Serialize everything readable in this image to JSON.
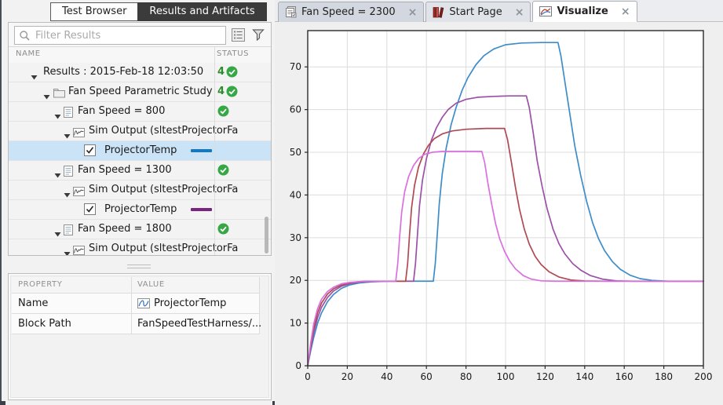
{
  "left_panel": {
    "tabs": [
      {
        "label": "Test Browser",
        "active": false
      },
      {
        "label": "Results and Artifacts",
        "active": true
      }
    ],
    "filter": {
      "placeholder": "Filter Results"
    },
    "tree": {
      "columns": {
        "name": "NAME",
        "status": "STATUS"
      },
      "rows": [
        {
          "label": "Results : 2015-Feb-18 12:03:50",
          "indent": 1,
          "expander": true,
          "icon": "none",
          "status_count": "4",
          "status_check": true,
          "selected": false
        },
        {
          "label": "Fan Speed Parametric Study",
          "indent": 2,
          "expander": true,
          "icon": "folder",
          "status_count": "4",
          "status_check": true,
          "selected": false
        },
        {
          "label": "Fan Speed = 800",
          "indent": 3,
          "expander": true,
          "icon": "document",
          "status_check": true,
          "selected": false
        },
        {
          "label": "Sim Output (sltestProjectorFa",
          "indent": 4,
          "expander": true,
          "icon": "signal",
          "selected": false
        },
        {
          "label": "ProjectorTemp",
          "indent": 5,
          "checkbox": true,
          "swatch": "#1878BE",
          "selected": true
        },
        {
          "label": "Fan Speed = 1300",
          "indent": 3,
          "expander": true,
          "icon": "document",
          "status_check": true,
          "selected": false
        },
        {
          "label": "Sim Output (sltestProjectorFa",
          "indent": 4,
          "expander": true,
          "icon": "signal",
          "selected": false
        },
        {
          "label": "ProjectorTemp",
          "indent": 5,
          "checkbox": true,
          "swatch": "#7A2482",
          "selected": false
        },
        {
          "label": "Fan Speed = 1800",
          "indent": 3,
          "expander": true,
          "icon": "document",
          "status_check": true,
          "selected": false
        },
        {
          "label": "Sim Output (sltestProjectorFa",
          "indent": 4,
          "expander": true,
          "icon": "signal",
          "selected": false
        }
      ]
    },
    "properties": {
      "columns": {
        "property": "PROPERTY",
        "value": "VALUE"
      },
      "rows": [
        {
          "property": "Name",
          "value": "ProjectorTemp",
          "icon": "signal-wave"
        },
        {
          "property": "Block Path",
          "value": "FanSpeedTestHarness/...",
          "icon": "none"
        }
      ]
    },
    "colors": {
      "selected_row": "#CBE3F7",
      "pass_green": "#35A845",
      "count_green": "#2E8B2E",
      "active_tab_bg": "#3B3B3B"
    }
  },
  "right_panel": {
    "tabs": [
      {
        "label": "Fan Speed = 2300",
        "icon": "report-icon",
        "close": "×",
        "active": false
      },
      {
        "label": "Start Page",
        "icon": "books-icon",
        "close": "×",
        "active": false
      },
      {
        "label": "Visualize",
        "icon": "plot-icon",
        "close": "×",
        "active": true
      }
    ]
  },
  "chart_data": {
    "type": "line",
    "title": "",
    "xlabel": "",
    "ylabel": "",
    "xlim": [
      0,
      200
    ],
    "ylim": [
      0,
      78.5
    ],
    "xticks": [
      0,
      20,
      40,
      60,
      80,
      100,
      120,
      140,
      160,
      180,
      200
    ],
    "yticks": [
      0,
      10,
      20,
      30,
      40,
      50,
      60,
      70
    ],
    "grid": true,
    "legend_position": "none",
    "series": [
      {
        "name": "ProjectorTemp (Fan Speed = 800)",
        "color": "#3E8DC9",
        "points": [
          [
            0,
            0
          ],
          [
            1.5,
            3.5
          ],
          [
            3,
            6.6
          ],
          [
            5,
            10
          ],
          [
            7,
            12.4
          ],
          [
            10,
            15
          ],
          [
            13,
            16.7
          ],
          [
            17,
            18.1
          ],
          [
            21,
            18.9
          ],
          [
            26,
            19.4
          ],
          [
            32,
            19.65
          ],
          [
            40,
            19.8
          ],
          [
            63.5,
            19.8
          ],
          [
            64.5,
            24
          ],
          [
            65.5,
            31
          ],
          [
            66.5,
            38
          ],
          [
            68,
            45
          ],
          [
            70,
            51
          ],
          [
            72.5,
            56.5
          ],
          [
            75,
            60.5
          ],
          [
            78,
            64.5
          ],
          [
            81,
            67.5
          ],
          [
            85,
            70.5
          ],
          [
            89,
            72.6
          ],
          [
            94,
            74.2
          ],
          [
            100,
            75.2
          ],
          [
            108,
            75.6
          ],
          [
            118,
            75.7
          ],
          [
            126.5,
            75.7
          ],
          [
            128,
            72.5
          ],
          [
            130,
            66.5
          ],
          [
            132.5,
            59
          ],
          [
            135,
            51.5
          ],
          [
            138,
            44.5
          ],
          [
            141,
            38.5
          ],
          [
            144,
            33.5
          ],
          [
            147,
            29.8
          ],
          [
            150,
            27
          ],
          [
            154,
            24.4
          ],
          [
            158,
            22.6
          ],
          [
            163,
            21.2
          ],
          [
            168,
            20.4
          ],
          [
            174,
            20
          ],
          [
            182,
            19.8
          ],
          [
            200,
            19.8
          ]
        ]
      },
      {
        "name": "ProjectorTemp (Fan Speed = 1300)",
        "color": "#9C50A8",
        "points": [
          [
            0,
            0
          ],
          [
            1.5,
            4.2
          ],
          [
            3,
            7.8
          ],
          [
            5,
            11.3
          ],
          [
            7,
            13.7
          ],
          [
            10,
            16
          ],
          [
            13,
            17.5
          ],
          [
            17,
            18.6
          ],
          [
            21,
            19.2
          ],
          [
            26,
            19.6
          ],
          [
            33,
            19.8
          ],
          [
            53.5,
            19.8
          ],
          [
            54.5,
            24
          ],
          [
            55.5,
            31
          ],
          [
            56.5,
            37.5
          ],
          [
            58,
            43.5
          ],
          [
            60,
            48.5
          ],
          [
            62.5,
            52.8
          ],
          [
            65,
            55.7
          ],
          [
            68,
            58.2
          ],
          [
            71,
            60
          ],
          [
            75,
            61.5
          ],
          [
            80,
            62.4
          ],
          [
            86,
            62.9
          ],
          [
            94,
            63.1
          ],
          [
            102,
            63.2
          ],
          [
            110.5,
            63.2
          ],
          [
            112,
            60.5
          ],
          [
            114,
            54.5
          ],
          [
            116,
            48
          ],
          [
            118.5,
            42
          ],
          [
            121,
            36.8
          ],
          [
            124,
            32
          ],
          [
            127,
            28.6
          ],
          [
            130,
            26.2
          ],
          [
            134,
            23.9
          ],
          [
            138,
            22.4
          ],
          [
            143,
            21.1
          ],
          [
            149,
            20.3
          ],
          [
            156,
            19.9
          ],
          [
            164,
            19.8
          ],
          [
            200,
            19.8
          ]
        ]
      },
      {
        "name": "ProjectorTemp (Fan Speed = 1800)",
        "color": "#B04A52",
        "points": [
          [
            0,
            0
          ],
          [
            1.5,
            4.8
          ],
          [
            3,
            8.8
          ],
          [
            5,
            12.4
          ],
          [
            7,
            14.7
          ],
          [
            10,
            16.8
          ],
          [
            13,
            18
          ],
          [
            17,
            18.9
          ],
          [
            21,
            19.4
          ],
          [
            26,
            19.7
          ],
          [
            32,
            19.8
          ],
          [
            49.5,
            19.8
          ],
          [
            50.5,
            24
          ],
          [
            51.5,
            31
          ],
          [
            52.5,
            37
          ],
          [
            54,
            42.3
          ],
          [
            56,
            46.5
          ],
          [
            58.5,
            49.6
          ],
          [
            61,
            51.6
          ],
          [
            64,
            53.2
          ],
          [
            68,
            54.3
          ],
          [
            73,
            55
          ],
          [
            80,
            55.4
          ],
          [
            90,
            55.6
          ],
          [
            99.5,
            55.6
          ],
          [
            101,
            53
          ],
          [
            103,
            47.5
          ],
          [
            105,
            41.8
          ],
          [
            107,
            36.8
          ],
          [
            109.5,
            32
          ],
          [
            112,
            28.5
          ],
          [
            115,
            25.6
          ],
          [
            118,
            23.7
          ],
          [
            122,
            22
          ],
          [
            127,
            20.8
          ],
          [
            133,
            20.1
          ],
          [
            140,
            19.85
          ],
          [
            150,
            19.8
          ],
          [
            200,
            19.8
          ]
        ]
      },
      {
        "name": "ProjectorTemp (Fan Speed = 2300)",
        "color": "#DA70DF",
        "points": [
          [
            0,
            0
          ],
          [
            1.5,
            5.4
          ],
          [
            3,
            9.8
          ],
          [
            5,
            13.4
          ],
          [
            7,
            15.6
          ],
          [
            10,
            17.4
          ],
          [
            13,
            18.4
          ],
          [
            17,
            19.2
          ],
          [
            21,
            19.5
          ],
          [
            26,
            19.7
          ],
          [
            31,
            19.8
          ],
          [
            44.5,
            19.8
          ],
          [
            45.5,
            24
          ],
          [
            46.5,
            30.5
          ],
          [
            47.5,
            36
          ],
          [
            49,
            40.8
          ],
          [
            51,
            44.3
          ],
          [
            53.5,
            46.9
          ],
          [
            56,
            48.5
          ],
          [
            59,
            49.5
          ],
          [
            63,
            50
          ],
          [
            68,
            50.2
          ],
          [
            78,
            50.2
          ],
          [
            88,
            50.2
          ],
          [
            89.5,
            47.5
          ],
          [
            91,
            43
          ],
          [
            93,
            37.8
          ],
          [
            95,
            33.2
          ],
          [
            97,
            29.8
          ],
          [
            99.5,
            26.8
          ],
          [
            102,
            24.6
          ],
          [
            105,
            22.7
          ],
          [
            109,
            21.1
          ],
          [
            113,
            20.3
          ],
          [
            118,
            19.9
          ],
          [
            125,
            19.8
          ],
          [
            200,
            19.8
          ]
        ]
      }
    ]
  }
}
